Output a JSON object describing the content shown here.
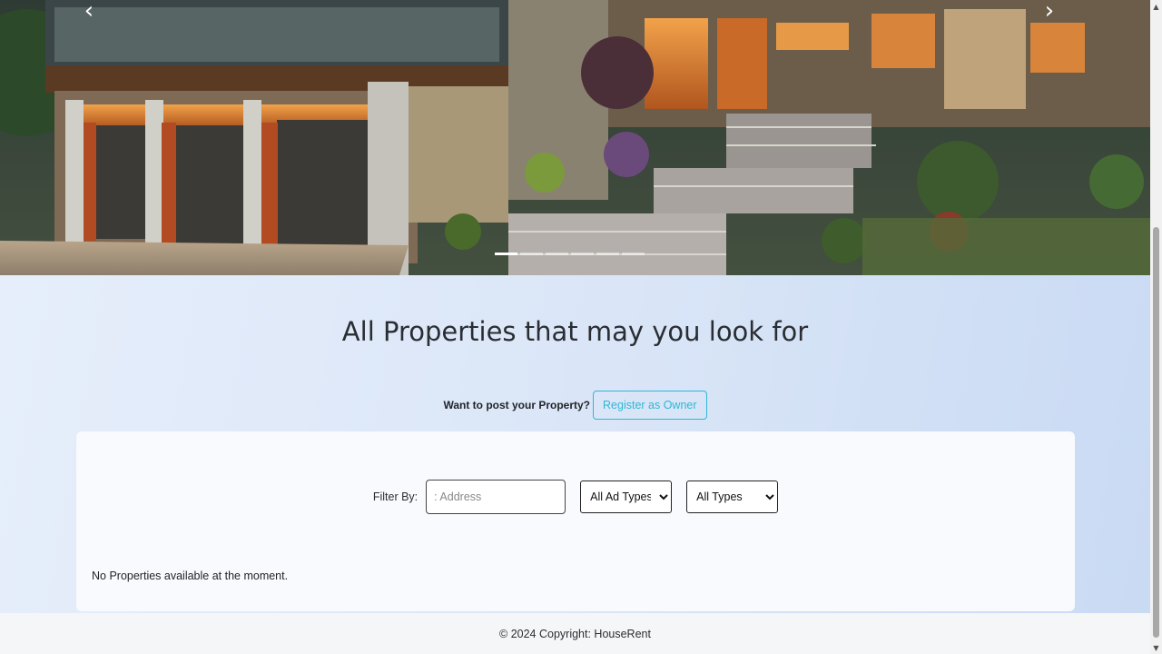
{
  "carousel": {
    "prev_icon": "‹",
    "next_icon": "›",
    "slide_count": 6,
    "active_slide": 0
  },
  "main": {
    "title": "All Properties that may you look for",
    "owner_prompt": "Want to post your Property?",
    "register_label": "Register as Owner"
  },
  "filter": {
    "label": "Filter By:",
    "address_placeholder": ": Address",
    "ad_type_selected": "All Ad Types",
    "type_selected": "All Types"
  },
  "listing": {
    "empty_message": "No Properties available at the moment."
  },
  "footer": {
    "copyright": "© 2024 Copyright: HouseRent"
  },
  "colors": {
    "accent": "#2fb8d6",
    "background": "#d9e5f7"
  }
}
